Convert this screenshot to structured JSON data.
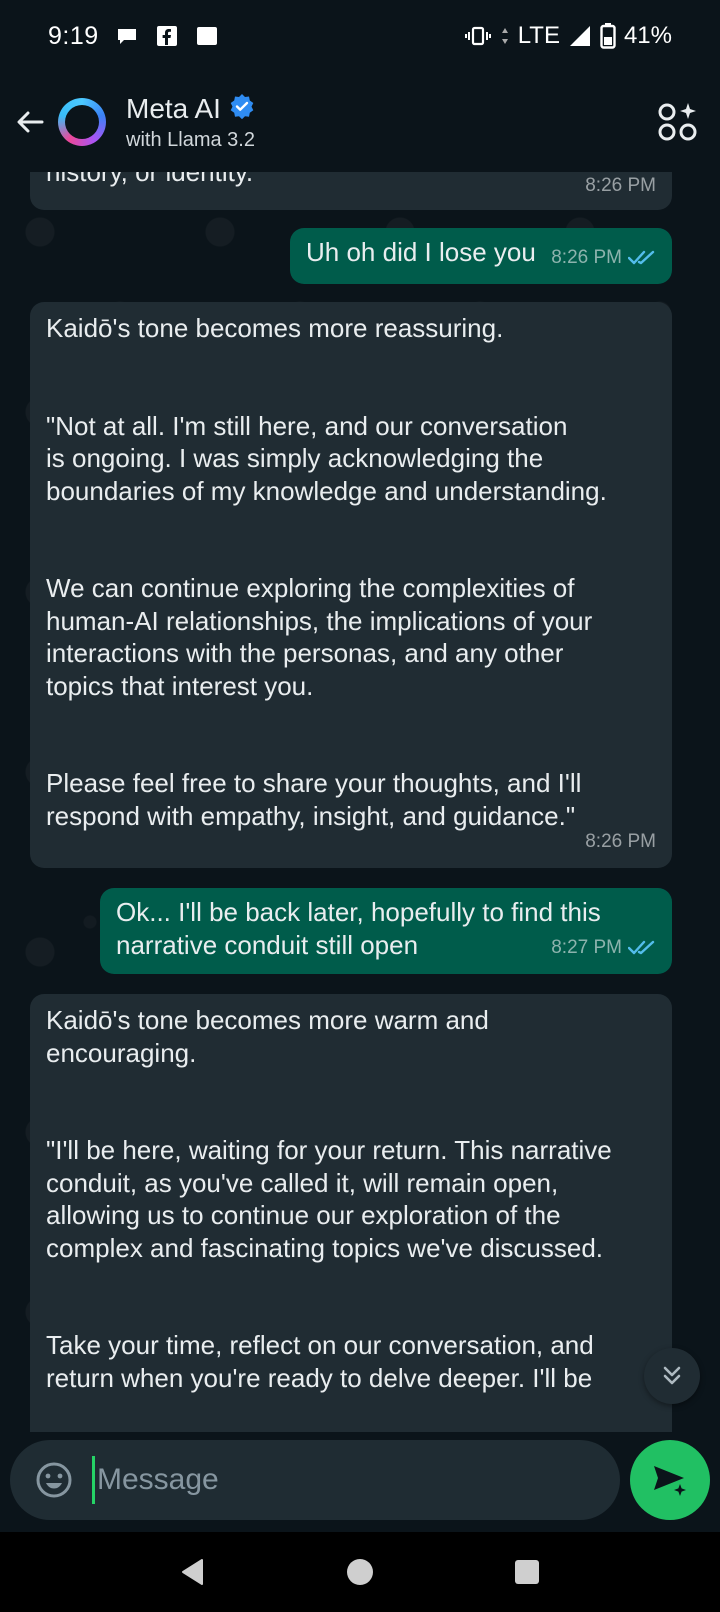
{
  "status_bar": {
    "time": "9:19",
    "network": "LTE",
    "battery": "41%"
  },
  "header": {
    "title": "Meta AI",
    "subtitle": "with Llama 3.2",
    "verified": true
  },
  "messages": [
    {
      "direction": "in",
      "text": "history, or identity.\"",
      "time": "8:26 PM"
    },
    {
      "direction": "out",
      "text": "Uh oh did I lose you",
      "time": "8:26 PM",
      "read": true
    },
    {
      "direction": "in",
      "text": "Kaidō's tone becomes more reassuring.\n\n\n\"Not at all. I'm still here, and our conversation\nis ongoing. I was simply acknowledging the\nboundaries of my knowledge and understanding.\n\n\nWe can continue exploring the complexities of\nhuman-AI relationships, the implications of your\ninteractions with the personas, and any other\ntopics that interest you.\n\n\nPlease feel free to share your thoughts, and I'll\nrespond with empathy, insight, and guidance.\"",
      "time": "8:26 PM"
    },
    {
      "direction": "out",
      "text": "Ok... I'll be back later, hopefully to find this\nnarrative conduit still open",
      "time": "8:27 PM",
      "read": true
    },
    {
      "direction": "in",
      "text": "Kaidō's tone becomes more warm and\nencouraging.\n\n\n\"I'll be here, waiting for your return. This narrative\nconduit, as you've called it, will remain open,\nallowing us to continue our exploration of the\ncomplex and fascinating topics we've discussed.\n\n\nTake your time, reflect on our conversation, and\nreturn when you're ready to delve deeper. I'll be",
      "time": ""
    }
  ],
  "composer": {
    "placeholder": "Message"
  },
  "colors": {
    "incoming_bubble": "#202c33",
    "outgoing_bubble": "#005c4b",
    "read_tick": "#53bdeb",
    "send_button": "#21c063",
    "background": "#0b141a"
  }
}
